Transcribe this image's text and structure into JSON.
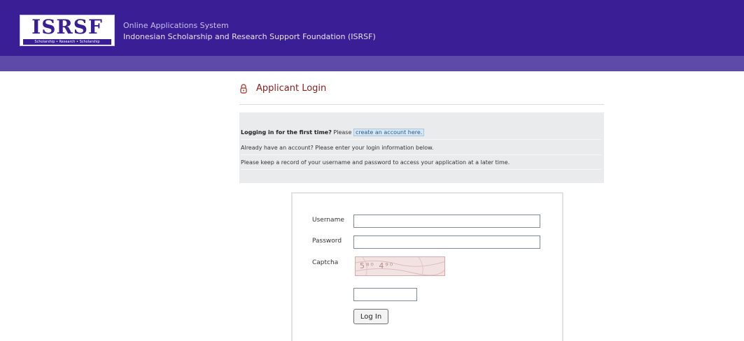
{
  "header": {
    "logo_text": "ISRSF",
    "logo_tagline": "Scholarship • Research • Scholarship",
    "system_name": "Online Applications System",
    "org_name": "Indonesian Scholarship and Research Support Foundation (ISRSF)",
    "brand_color": "#3a1e95",
    "subbar_color": "#5e4aa8"
  },
  "login": {
    "title": "Applicant Login",
    "title_icon": "lock-icon",
    "title_color": "#8b1c1c"
  },
  "info": {
    "first_time_bold": "Logging in for the first time?",
    "first_time_text": "Please",
    "create_link": "create an account here.",
    "line2": "Already have an account? Please enter your login information below.",
    "line3": "Please keep a record of your username and password to access your application at a later time."
  },
  "form": {
    "username_label": "Username",
    "username_value": "",
    "password_label": "Password",
    "password_value": "",
    "captcha_label": "Captcha",
    "captcha_text": "5⁸⁰ 4⁹⁰",
    "captcha_value": "",
    "submit_label": "Log In"
  }
}
